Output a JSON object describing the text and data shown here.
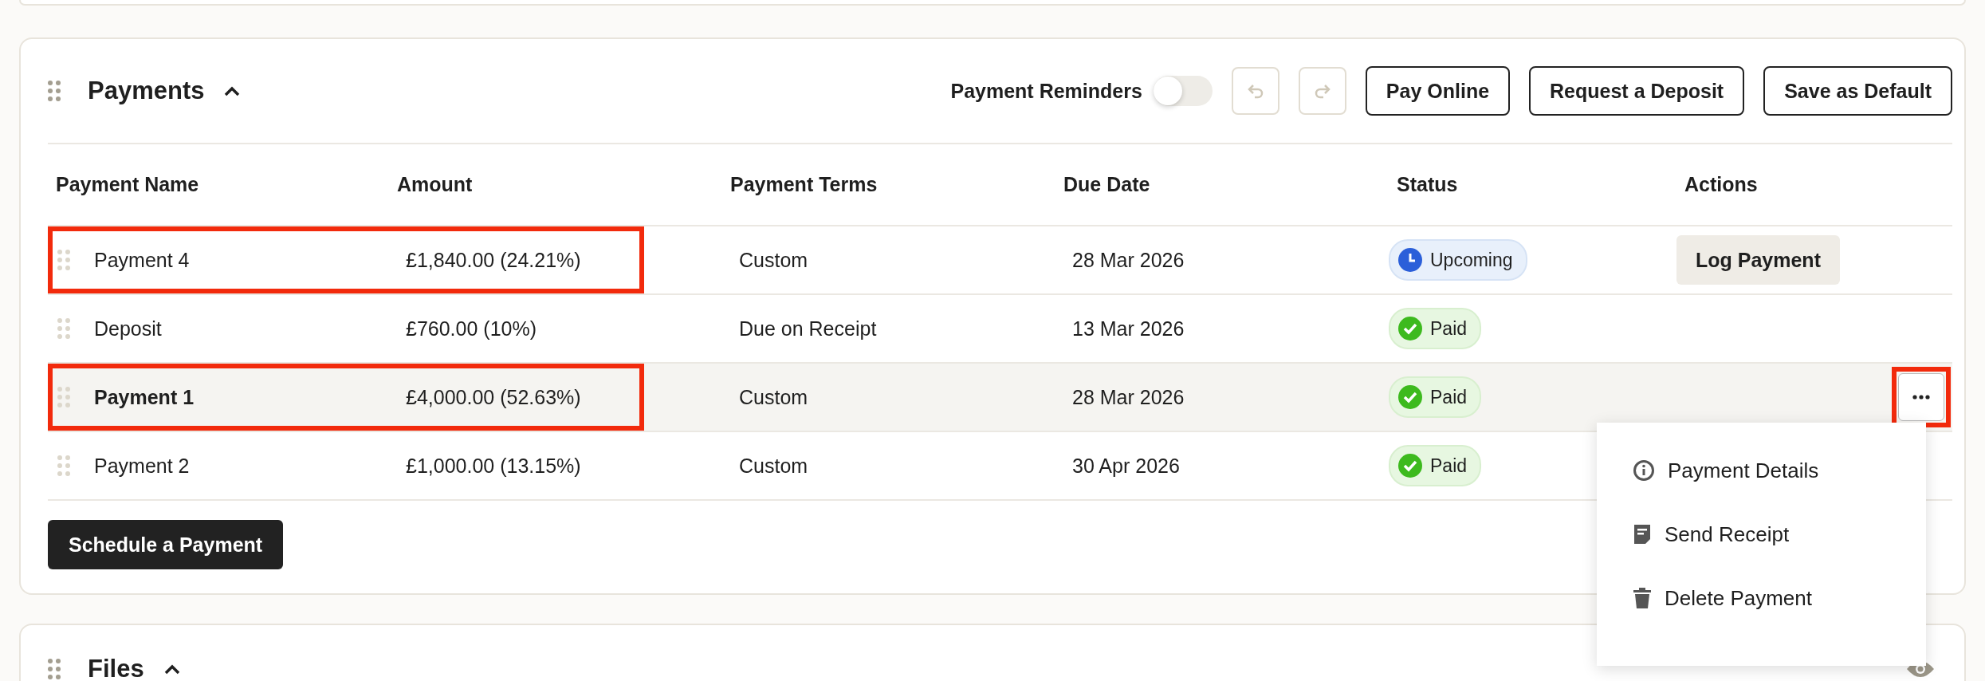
{
  "payments": {
    "title": "Payments",
    "expanded": true,
    "reminders": {
      "label": "Payment Reminders",
      "on": false
    },
    "undo": {
      "disabled": true
    },
    "redo": {
      "disabled": true
    },
    "buttons": [
      "Pay Online",
      "Request a Deposit",
      "Save as Default"
    ],
    "table": {
      "columns": [
        "Payment Name",
        "Amount",
        "Payment Terms",
        "Due Date",
        "Status",
        "Actions"
      ],
      "rows": [
        {
          "name": "Payment 4",
          "amount": "£1,840.00 (24.21%)",
          "terms": "Custom",
          "due": "28 Mar 2026",
          "status": {
            "kind": "upcoming",
            "label": "Upcoming"
          },
          "action": {
            "kind": "log",
            "label": "Log Payment"
          },
          "selected": false,
          "highlighted": true
        },
        {
          "name": "Deposit",
          "amount": "£760.00 (10%)",
          "terms": "Due on Receipt",
          "due": "13 Mar 2026",
          "status": {
            "kind": "paid",
            "label": "Paid"
          },
          "selected": false,
          "highlighted": false
        },
        {
          "name": "Payment 1",
          "amount": "£4,000.00 (52.63%)",
          "terms": "Custom",
          "due": "28 Mar 2026",
          "status": {
            "kind": "paid",
            "label": "Paid"
          },
          "action": {
            "kind": "menu",
            "highlighted": true
          },
          "selected": true,
          "highlighted": true
        },
        {
          "name": "Payment 2",
          "amount": "£1,000.00 (13.15%)",
          "terms": "Custom",
          "due": "30 Apr 2026",
          "status": {
            "kind": "paid",
            "label": "Paid"
          },
          "selected": false,
          "highlighted": false
        }
      ]
    },
    "schedule_button": "Schedule a Payment"
  },
  "menu": [
    {
      "kind": "info",
      "label": "Payment Details"
    },
    {
      "kind": "receipt",
      "label": "Send Receipt"
    },
    {
      "kind": "trash",
      "label": "Delete Payment"
    }
  ],
  "files": {
    "title": "Files",
    "expanded": true
  }
}
